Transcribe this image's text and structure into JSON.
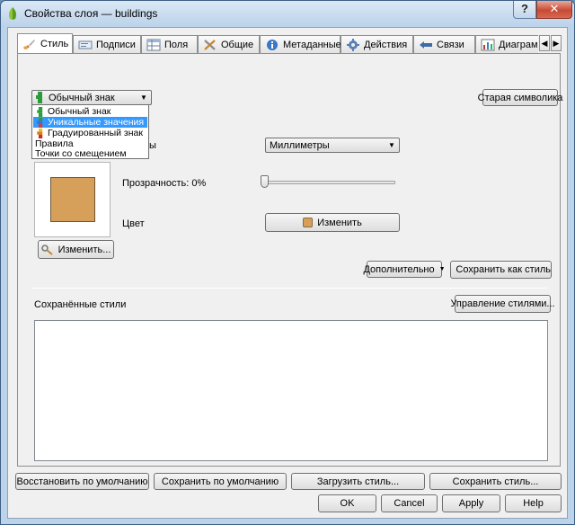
{
  "window": {
    "title": "Свойства слоя — buildings",
    "help_glyph": "?",
    "close_glyph": "✕"
  },
  "tabs": [
    {
      "label": "Стиль",
      "icon": "paintbrush-icon"
    },
    {
      "label": "Подписи",
      "icon": "label-icon"
    },
    {
      "label": "Поля",
      "icon": "table-icon"
    },
    {
      "label": "Общие",
      "icon": "tools-icon"
    },
    {
      "label": "Метаданные",
      "icon": "info-icon"
    },
    {
      "label": "Действия",
      "icon": "gear-icon"
    },
    {
      "label": "Связи",
      "icon": "join-icon"
    },
    {
      "label": "Диаграм",
      "icon": "chart-icon"
    }
  ],
  "style": {
    "renderer_value": "Обычный знак",
    "renderer_options": [
      {
        "label": "Обычный знак",
        "icon": "single-symbol-icon"
      },
      {
        "label": "Уникальные значения",
        "icon": "categorized-icon"
      },
      {
        "label": "Градуированный знак",
        "icon": "graduated-icon"
      },
      {
        "label": "Правила"
      },
      {
        "label": "Точки со смещением"
      }
    ],
    "selected_option_index": 1,
    "old_symbology_label": "Старая символика",
    "units_label_partial": "ы",
    "units_value": "Миллиметры",
    "transparency_label": "Прозрачность: 0%",
    "transparency_value_pct": 0,
    "color_label": "Цвет",
    "color_button_label": "Изменить",
    "symbol_color": "#d6a05b",
    "change_button_label": "Изменить...",
    "advanced_label": "Дополнительно",
    "save_as_style_label": "Сохранить как стиль",
    "saved_styles_label": "Сохранённые стили",
    "manage_styles_label": "Управление стилями..."
  },
  "bottom": {
    "restore_default": "Восстановить по умолчанию",
    "save_default": "Сохранить по умолчанию",
    "load_style": "Загрузить стиль...",
    "save_style": "Сохранить стиль...",
    "ok": "OK",
    "cancel": "Cancel",
    "apply": "Apply",
    "help": "Help"
  },
  "glyphs": {
    "dropdown_arrow": "▼",
    "tab_scroll_left": "◀",
    "tab_scroll_right": "▶"
  }
}
